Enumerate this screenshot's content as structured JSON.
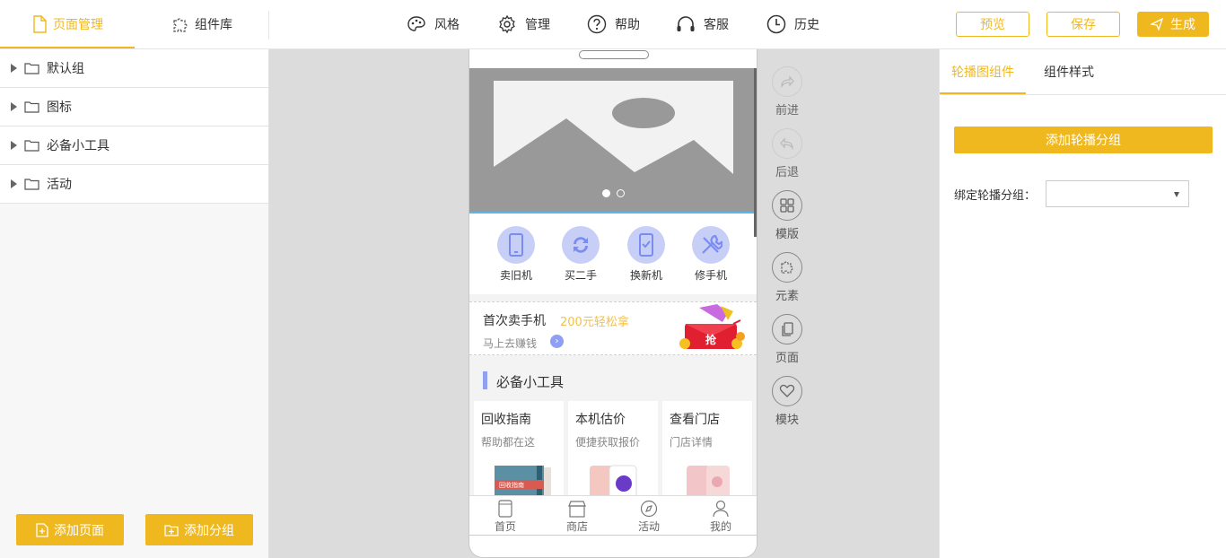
{
  "topbar": {
    "tabs": [
      {
        "label": "页面管理",
        "icon": "page-icon"
      },
      {
        "label": "组件库",
        "icon": "puzzle-icon"
      }
    ],
    "nav": [
      {
        "label": "风格",
        "icon": "palette-icon"
      },
      {
        "label": "管理",
        "icon": "gear-icon"
      },
      {
        "label": "帮助",
        "icon": "help-icon"
      },
      {
        "label": "客服",
        "icon": "headset-icon"
      },
      {
        "label": "历史",
        "icon": "clock-icon"
      }
    ],
    "preview_label": "预览",
    "save_label": "保存",
    "generate_label": "生成"
  },
  "sidebar": {
    "groups": [
      {
        "label": "默认组"
      },
      {
        "label": "图标"
      },
      {
        "label": "必备小工具"
      },
      {
        "label": "活动"
      }
    ],
    "add_page_label": "添加页面",
    "add_group_label": "添加分组"
  },
  "phone": {
    "icons": [
      {
        "label": "卖旧机"
      },
      {
        "label": "买二手"
      },
      {
        "label": "换新机"
      },
      {
        "label": "修手机"
      }
    ],
    "promo": {
      "title": "首次卖手机",
      "highlight": "200元轻松拿",
      "subtitle": "马上去赚钱",
      "badge": "抢"
    },
    "tools_title": "必备小工具",
    "tool_cards": [
      {
        "title": "回收指南",
        "subtitle": "帮助都在这",
        "book_label": "回收指南"
      },
      {
        "title": "本机估价",
        "subtitle": "便捷获取报价"
      },
      {
        "title": "查看门店",
        "subtitle": "门店详情"
      }
    ],
    "tabbar": [
      {
        "label": "首页"
      },
      {
        "label": "商店"
      },
      {
        "label": "活动"
      },
      {
        "label": "我的"
      }
    ]
  },
  "toolcol": [
    {
      "label": "前进",
      "icon": "forward-icon"
    },
    {
      "label": "后退",
      "icon": "back-icon"
    },
    {
      "label": "模版",
      "icon": "template-icon"
    },
    {
      "label": "元素",
      "icon": "element-icon"
    },
    {
      "label": "页面",
      "icon": "pages-icon"
    },
    {
      "label": "模块",
      "icon": "heart-icon"
    }
  ],
  "rightpanel": {
    "tabs": [
      {
        "label": "轮播图组件"
      },
      {
        "label": "组件样式"
      }
    ],
    "add_button": "添加轮播分组",
    "bind_label": "绑定轮播分组：",
    "select_value": ""
  },
  "colors": {
    "accent": "#f0b81f",
    "icon_bg": "#c7cff7",
    "icon_fg": "#7b8cf0"
  }
}
